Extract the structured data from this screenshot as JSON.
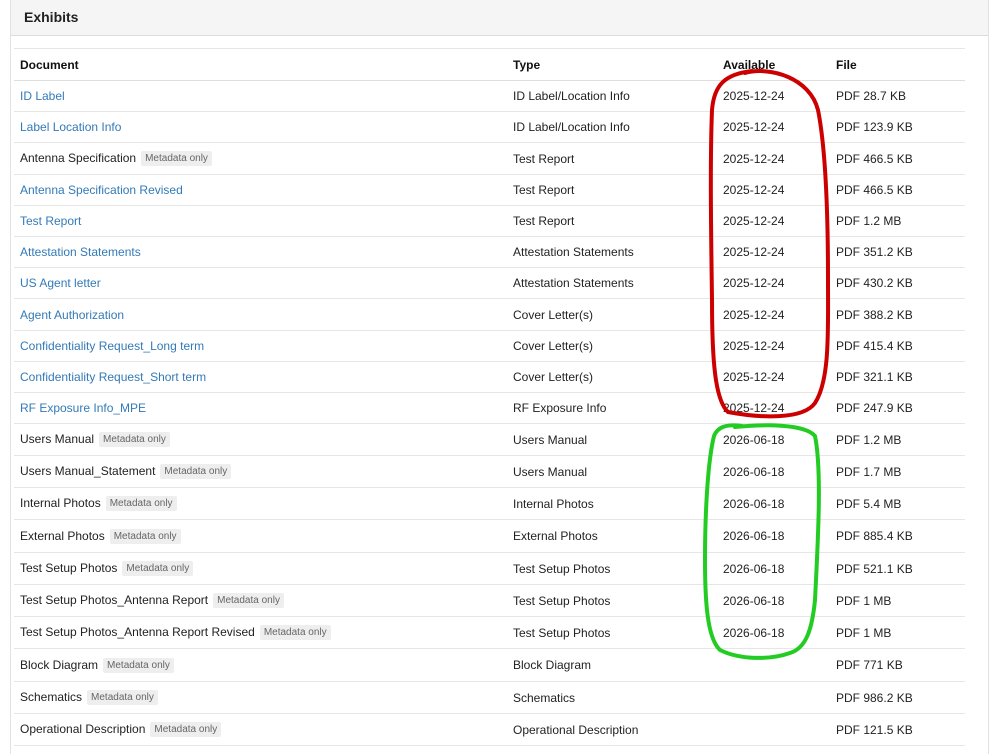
{
  "panel": {
    "title": "Exhibits"
  },
  "columns": {
    "document": "Document",
    "type": "Type",
    "available": "Available",
    "file": "File"
  },
  "rows": [
    {
      "document": "ID Label",
      "link": true,
      "badge": "",
      "type": "ID Label/Location Info",
      "available": "2025-12-24",
      "file": "PDF 28.7 KB"
    },
    {
      "document": "Label Location Info",
      "link": true,
      "badge": "",
      "type": "ID Label/Location Info",
      "available": "2025-12-24",
      "file": "PDF 123.9 KB"
    },
    {
      "document": "Antenna Specification",
      "link": false,
      "badge": "Metadata only",
      "type": "Test Report",
      "available": "2025-12-24",
      "file": "PDF 466.5 KB"
    },
    {
      "document": "Antenna Specification Revised",
      "link": true,
      "badge": "",
      "type": "Test Report",
      "available": "2025-12-24",
      "file": "PDF 466.5 KB"
    },
    {
      "document": "Test Report",
      "link": true,
      "badge": "",
      "type": "Test Report",
      "available": "2025-12-24",
      "file": "PDF 1.2 MB"
    },
    {
      "document": "Attestation Statements",
      "link": true,
      "badge": "",
      "type": "Attestation Statements",
      "available": "2025-12-24",
      "file": "PDF 351.2 KB"
    },
    {
      "document": "US Agent letter",
      "link": true,
      "badge": "",
      "type": "Attestation Statements",
      "available": "2025-12-24",
      "file": "PDF 430.2 KB"
    },
    {
      "document": "Agent Authorization",
      "link": true,
      "badge": "",
      "type": "Cover Letter(s)",
      "available": "2025-12-24",
      "file": "PDF 388.2 KB"
    },
    {
      "document": "Confidentiality Request_Long term",
      "link": true,
      "badge": "",
      "type": "Cover Letter(s)",
      "available": "2025-12-24",
      "file": "PDF 415.4 KB"
    },
    {
      "document": "Confidentiality Request_Short term",
      "link": true,
      "badge": "",
      "type": "Cover Letter(s)",
      "available": "2025-12-24",
      "file": "PDF 321.1 KB"
    },
    {
      "document": "RF Exposure Info_MPE",
      "link": true,
      "badge": "",
      "type": "RF Exposure Info",
      "available": "2025-12-24",
      "file": "PDF 247.9 KB"
    },
    {
      "document": "Users Manual",
      "link": false,
      "badge": "Metadata only",
      "type": "Users Manual",
      "available": "2026-06-18",
      "file": "PDF 1.2 MB"
    },
    {
      "document": "Users Manual_Statement",
      "link": false,
      "badge": "Metadata only",
      "type": "Users Manual",
      "available": "2026-06-18",
      "file": "PDF 1.7 MB"
    },
    {
      "document": "Internal Photos",
      "link": false,
      "badge": "Metadata only",
      "type": "Internal Photos",
      "available": "2026-06-18",
      "file": "PDF 5.4 MB"
    },
    {
      "document": "External Photos",
      "link": false,
      "badge": "Metadata only",
      "type": "External Photos",
      "available": "2026-06-18",
      "file": "PDF 885.4 KB"
    },
    {
      "document": "Test Setup Photos",
      "link": false,
      "badge": "Metadata only",
      "type": "Test Setup Photos",
      "available": "2026-06-18",
      "file": "PDF 521.1 KB"
    },
    {
      "document": "Test Setup Photos_Antenna Report",
      "link": false,
      "badge": "Metadata only",
      "type": "Test Setup Photos",
      "available": "2026-06-18",
      "file": "PDF 1 MB"
    },
    {
      "document": "Test Setup Photos_Antenna Report Revised",
      "link": false,
      "badge": "Metadata only",
      "type": "Test Setup Photos",
      "available": "2026-06-18",
      "file": "PDF 1 MB"
    },
    {
      "document": "Block Diagram",
      "link": false,
      "badge": "Metadata only",
      "type": "Block Diagram",
      "available": "",
      "file": "PDF 771 KB"
    },
    {
      "document": "Schematics",
      "link": false,
      "badge": "Metadata only",
      "type": "Schematics",
      "available": "",
      "file": "PDF 986.2 KB"
    },
    {
      "document": "Operational Description",
      "link": false,
      "badge": "Metadata only",
      "type": "Operational Description",
      "available": "",
      "file": "PDF 121.5 KB"
    }
  ],
  "annotations": {
    "red_circle_color": "#cc0000",
    "green_circle_color": "#22cc22"
  }
}
